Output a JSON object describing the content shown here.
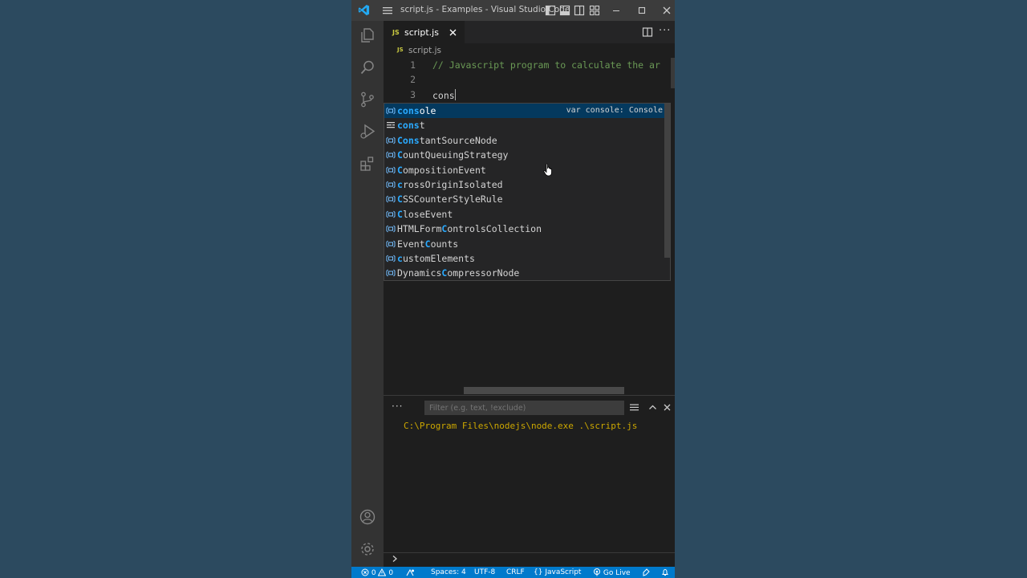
{
  "window": {
    "title": "script.js - Examples - Visual Studio Code"
  },
  "tab": {
    "badge": "JS",
    "name": "script.js"
  },
  "breadcrumb": {
    "badge": "JS",
    "file": "script.js"
  },
  "editor": {
    "lines": [
      {
        "number": "1",
        "text": "// Javascript program to calculate the ar"
      },
      {
        "number": "2",
        "text": ""
      },
      {
        "number": "3",
        "text": "cons"
      }
    ]
  },
  "suggest": {
    "items": [
      {
        "kind": "variable-icon",
        "pre": "",
        "match": "cons",
        "post": "ole",
        "detail": "var console: Console"
      },
      {
        "kind": "keyword-icon",
        "pre": "",
        "match": "cons",
        "post": "t",
        "detail": ""
      },
      {
        "kind": "variable-icon",
        "pre": "",
        "match": "Cons",
        "post": "tantSourceNode",
        "detail": ""
      },
      {
        "kind": "variable-icon",
        "pre": "",
        "match": "C",
        "post": "ountQueuingStrategy",
        "detail": ""
      },
      {
        "kind": "variable-icon",
        "pre": "",
        "match": "C",
        "post": "ompositionEvent",
        "detail": ""
      },
      {
        "kind": "variable-icon",
        "pre": "",
        "match": "c",
        "post": "rossOriginIsolated",
        "detail": ""
      },
      {
        "kind": "variable-icon",
        "pre": "",
        "match": "C",
        "post": "SSCounterStyleRule",
        "detail": ""
      },
      {
        "kind": "variable-icon",
        "pre": "",
        "match": "C",
        "post": "loseEvent",
        "detail": ""
      },
      {
        "kind": "variable-icon",
        "pre": "HTMLForm",
        "match": "C",
        "post": "ontrolsCollection",
        "detail": ""
      },
      {
        "kind": "variable-icon",
        "pre": "Event",
        "match": "C",
        "post": "ounts",
        "detail": ""
      },
      {
        "kind": "variable-icon",
        "pre": "",
        "match": "c",
        "post": "ustomElements",
        "detail": ""
      },
      {
        "kind": "variable-icon",
        "pre": "Dynamics",
        "match": "C",
        "post": "ompressorNode",
        "detail": ""
      }
    ]
  },
  "panel": {
    "more": "···",
    "filter_placeholder": "Filter (e.g. text, !exclude)",
    "output": "C:\\Program Files\\nodejs\\node.exe .\\script.js"
  },
  "statusbar": {
    "errors": "0",
    "warnings": "0",
    "spaces": "Spaces: 4",
    "encoding": "UTF-8",
    "eol": "CRLF",
    "language_braces": "{}",
    "language": "JavaScript",
    "golive": "Go Live"
  },
  "colors": {
    "accent": "#007acc",
    "match": "#2aaaff",
    "comment": "#6a9955",
    "output": "#cca700",
    "background": "#2c4a5f"
  }
}
